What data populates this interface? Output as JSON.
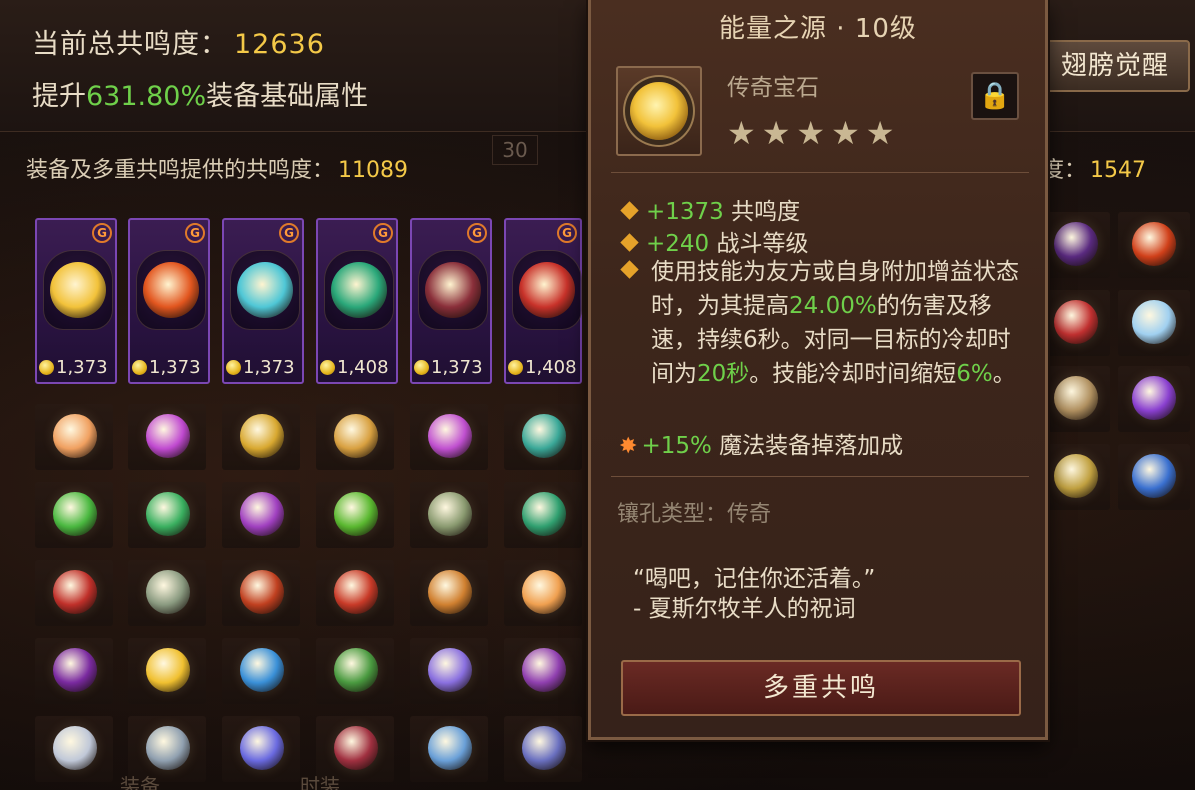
{
  "header": {
    "total_label": "当前总共鸣度：",
    "total_value": "12636",
    "boost_prefix": "提升",
    "boost_pct": "631.80%",
    "boost_suffix": "装备基础属性",
    "awaken_button": "翅膀觉醒"
  },
  "equip": {
    "label": "装备及多重共鸣提供的共鸣度：",
    "value": "11089",
    "ghost": "30"
  },
  "right_panel": {
    "label": "度：",
    "value": "1547"
  },
  "cards": [
    {
      "value": "1,373",
      "gem_color": "#f2c23a"
    },
    {
      "value": "1,373",
      "gem_color": "#e2561f"
    },
    {
      "value": "1,373",
      "gem_color": "#4fc7d6"
    },
    {
      "value": "1,408",
      "gem_color": "#2aa87a"
    },
    {
      "value": "1,373",
      "gem_color": "#8a2f3a"
    },
    {
      "value": "1,408",
      "gem_color": "#c8322a"
    }
  ],
  "tooltip": {
    "title": "能量之源 · 10级",
    "type": "传奇宝石",
    "stars": "★★★★★",
    "lock_icon": "🔒",
    "stat1_value": "+1373",
    "stat1_label": " 共鸣度",
    "stat2_value": "+240",
    "stat2_label": " 战斗等级",
    "desc_part1": "使用技能为友方或自身附加增益状态时，为其提高",
    "desc_pct": "24.00%",
    "desc_part2": "的伤害及移速，持续6秒。对同一目标的冷却时间为",
    "desc_cd": "20秒",
    "desc_part3": "。技能冷却时间缩短",
    "desc_cdr": "6%",
    "desc_part4": "。",
    "stat4_value": "+15%",
    "stat4_label": " 魔法装备掉落加成",
    "socket_label": "镶孔类型：",
    "socket_value": "传奇",
    "quote_line1": "“喝吧，记住你还活着。”",
    "quote_line2": "- 夏斯尔牧羊人的祝词",
    "resonate_button": "多重共鸣"
  },
  "bottom_tabs": [
    "装备",
    "时装"
  ],
  "colors": {
    "accent_gold": "#f4c948",
    "accent_green": "#6fd04a",
    "card_purple": "#7b47b3"
  }
}
